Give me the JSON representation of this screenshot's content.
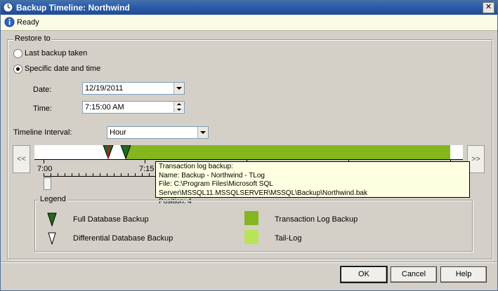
{
  "window": {
    "title": "Backup Timeline: Northwind"
  },
  "status": {
    "text": "Ready"
  },
  "restore_group": {
    "label": "Restore to",
    "option_last": "Last backup taken",
    "option_specific": "Specific date and time",
    "selected": "specific"
  },
  "date": {
    "label": "Date:",
    "value": "12/19/2011"
  },
  "time": {
    "label": "Time:",
    "value": "7:15:00 AM"
  },
  "timeline": {
    "interval_label": "Timeline Interval:",
    "interval_value": "Hour",
    "prev_label": "<<",
    "next_label": ">>",
    "tick_labels": [
      "7:00",
      "7:15"
    ]
  },
  "tooltip": {
    "line1": "Transaction log backup:",
    "line2": "Name: Backup - Northwind - TLog",
    "line3": "File: C:\\Program Files\\Microsoft SQL Server\\MSSQL11.MSSQLSERVER\\MSSQL\\Backup\\Northwind.bak",
    "line4": "Position: 4"
  },
  "legend": {
    "label": "Legend",
    "full": "Full Database Backup",
    "differential": "Differential Database Backup",
    "tlog": "Transaction Log Backup",
    "taillog": "Tail-Log"
  },
  "colors": {
    "tlog": "#84b61e",
    "taillog": "#b8e458",
    "full_marker": "#1f6b1f",
    "selected_marker": "#c0141c"
  },
  "buttons": {
    "ok": "OK",
    "cancel": "Cancel",
    "help": "Help"
  }
}
